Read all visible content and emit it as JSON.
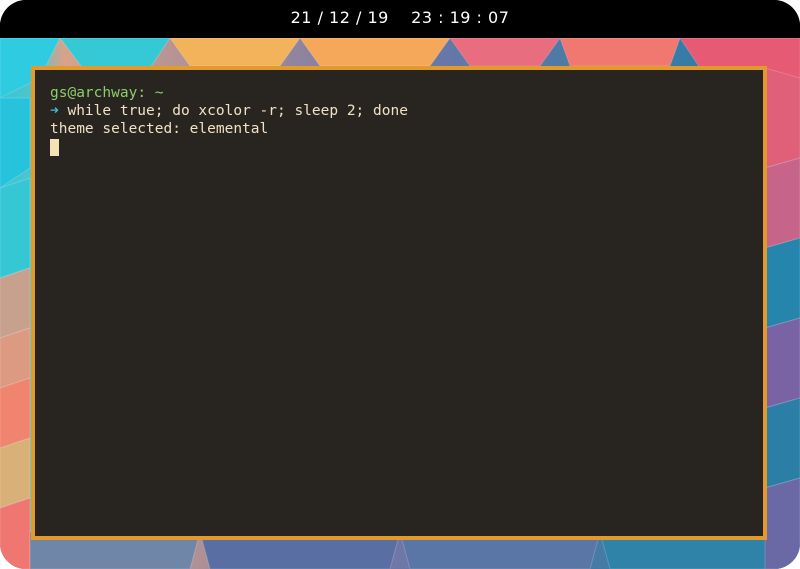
{
  "topbar": {
    "date": "21 / 12 / 19",
    "time": "23 : 19 : 07"
  },
  "terminal": {
    "prompt_user": "gs@archway",
    "prompt_path": ": ~",
    "prompt_symbol": "➜",
    "command": "while true; do xcolor -r; sleep 2; done",
    "output_line": "theme selected: elemental"
  },
  "colors": {
    "terminal_background": "#282420",
    "terminal_border": "#e39a2c",
    "prompt_user": "#8ccf6a",
    "prompt_arrow": "#3cc0d8",
    "text": "#f2e1c4",
    "bar_background": "#000000"
  }
}
